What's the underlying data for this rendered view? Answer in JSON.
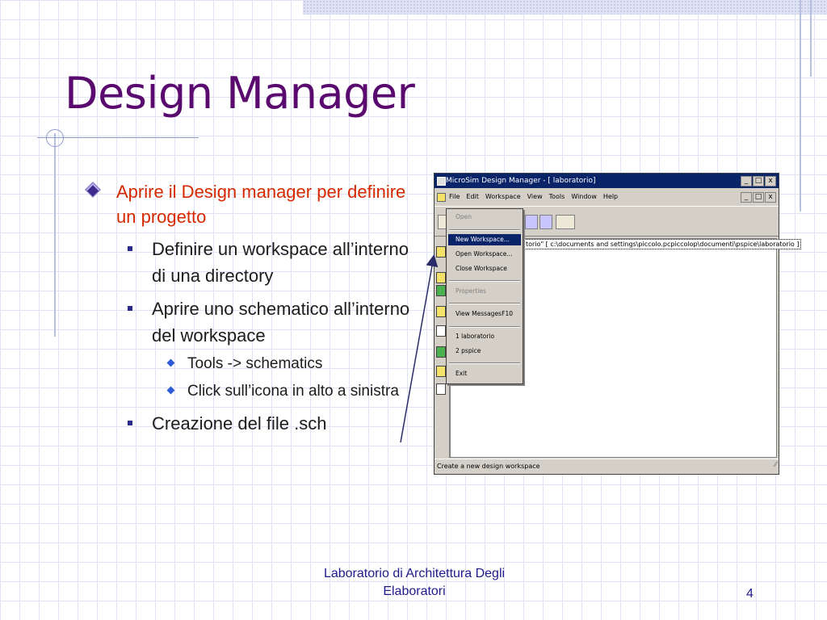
{
  "slide": {
    "title": "Design Manager",
    "bullets": {
      "main": "Aprire il Design manager per definire un progetto",
      "sub1": "Definire un workspace all’interno di una directory",
      "sub2": "Aprire uno schematico all’interno del workspace",
      "sub2a": "Tools -> schematics",
      "sub2b": "Click sull’icona in alto a sinistra",
      "sub3": "Creazione del file .sch"
    },
    "footer": {
      "line1": "Laboratorio di Architettura Degli",
      "line2": "Elaboratori",
      "page": "4"
    },
    "colors": {
      "title": "#5a0a6e",
      "main_bullet": "#d62800",
      "footer": "#1f1a8a",
      "window_title_bar": "#0a246a"
    }
  },
  "app": {
    "title": "MicroSim Design Manager - [ laboratorio]",
    "menu": [
      "File",
      "Edit",
      "Workspace",
      "View",
      "Tools",
      "Window",
      "Help"
    ],
    "min_label": "_",
    "max_label": "□",
    "close_label": "x",
    "path": "torio\" [ c:\\documents and settings\\piccolo.pcpiccolop\\documenti\\pspice\\laboratorio ]",
    "status": "Create a new design workspace",
    "file_menu": {
      "open": "Open",
      "new_workspace": "New Workspace...",
      "open_workspace": "Open Workspace...",
      "close_workspace": "Close Workspace",
      "properties": "Properties",
      "view_messages": "View Messages",
      "view_messages_key": "F10",
      "recent1": "1 laboratorio",
      "recent2": "2 pspice",
      "exit": "Exit"
    }
  }
}
